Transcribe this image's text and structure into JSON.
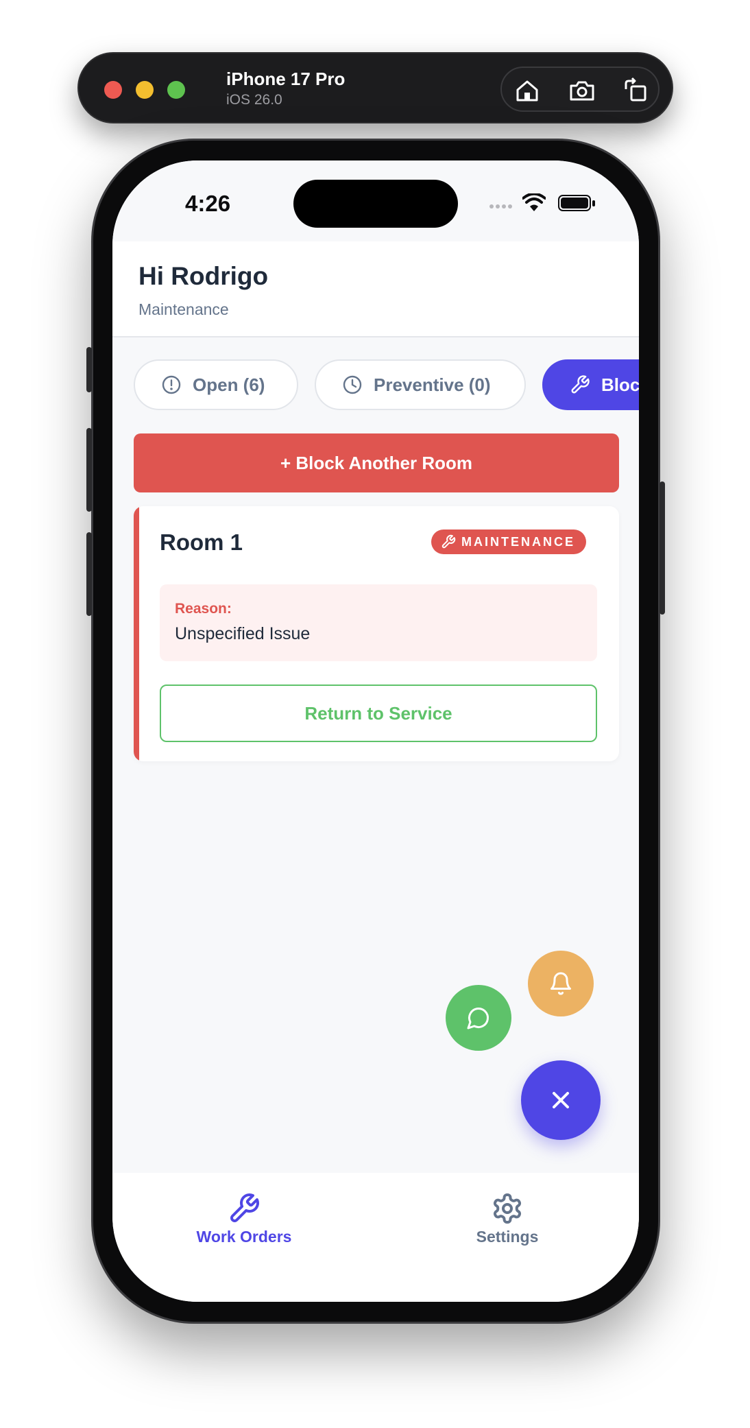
{
  "simulator": {
    "device_name": "iPhone 17 Pro",
    "os_version": "iOS 26.0",
    "actions": [
      "home-icon",
      "screenshot-icon",
      "rotate-icon"
    ]
  },
  "status_bar": {
    "time": "4:26"
  },
  "header": {
    "greeting": "Hi Rodrigo",
    "role": "Maintenance"
  },
  "tabs": [
    {
      "label": "Open (6)",
      "icon": "alert-circle-icon",
      "active": false
    },
    {
      "label": "Preventive (0)",
      "icon": "clock-icon",
      "active": false
    },
    {
      "label": "Blocked",
      "icon": "wrench-icon",
      "active": true
    }
  ],
  "actions": {
    "block_room_label": "+ Block Another Room"
  },
  "room_card": {
    "title": "Room 1",
    "badge": "MAINTENANCE",
    "reason_label": "Reason:",
    "reason_value": "Unspecified Issue",
    "return_label": "Return to Service"
  },
  "fabs": [
    "bell-icon",
    "chat-icon",
    "close-icon"
  ],
  "bottom_nav": {
    "items": [
      {
        "label": "Work Orders",
        "icon": "wrench-icon",
        "active": true
      },
      {
        "label": "Settings",
        "icon": "gear-icon",
        "active": false
      }
    ]
  },
  "colors": {
    "accent": "#4f46e5",
    "danger": "#df5550",
    "success": "#5ec26a",
    "warning": "#ecb263"
  }
}
